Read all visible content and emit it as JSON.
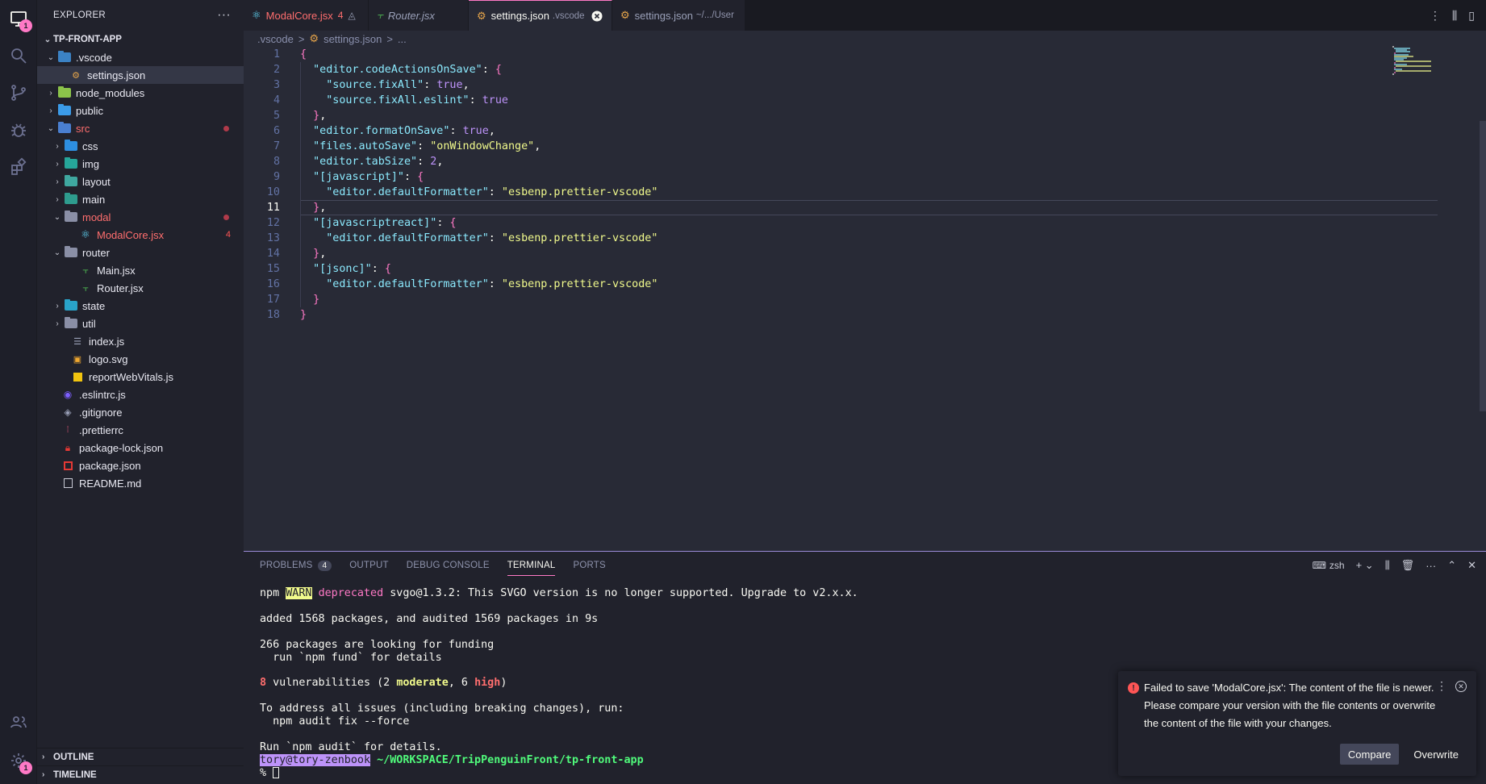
{
  "sidebar": {
    "title": "EXPLORER",
    "more": "···",
    "project": "TP-FRONT-APP",
    "tree": [
      {
        "label": "vscode_dot",
        "text": ".vscode"
      },
      {
        "text": "settings.json"
      },
      {
        "text": "node_modules"
      },
      {
        "text": "public"
      },
      {
        "text": "src"
      },
      {
        "text": "css"
      },
      {
        "text": "img"
      },
      {
        "text": "layout"
      },
      {
        "text": "main"
      },
      {
        "text": "modal"
      },
      {
        "text": "ModalCore.jsx",
        "count": "4"
      },
      {
        "text": "router"
      },
      {
        "text": "Main.jsx"
      },
      {
        "text": "Router.jsx"
      },
      {
        "text": "state"
      },
      {
        "text": "util"
      },
      {
        "text": "index.js"
      },
      {
        "text": "logo.svg"
      },
      {
        "text": "reportWebVitals.js"
      },
      {
        "text": ".eslintrc.js"
      },
      {
        "text": ".gitignore"
      },
      {
        "text": ".prettierrc"
      },
      {
        "text": "package-lock.json"
      },
      {
        "text": "package.json"
      },
      {
        "text": "README.md"
      }
    ],
    "outline": "OUTLINE",
    "timeline": "TIMELINE"
  },
  "activity": {
    "explorer_badge": "1",
    "settings_badge": "1"
  },
  "tabs": [
    {
      "label": "ModalCore.jsx",
      "count": "4"
    },
    {
      "label": "Router.jsx"
    },
    {
      "label": "settings.json",
      "desc": ".vscode"
    },
    {
      "label": "settings.json",
      "desc": "~/.../User"
    }
  ],
  "breadcrumb": {
    "part1": ".vscode",
    "sep": ">",
    "part2": "settings.json",
    "part3": "..."
  },
  "code": {
    "line_numbers": [
      "1",
      "2",
      "3",
      "4",
      "5",
      "6",
      "7",
      "8",
      "9",
      "10",
      "11",
      "12",
      "13",
      "14",
      "15",
      "16",
      "17",
      "18"
    ],
    "lines": [
      "{",
      "  \"editor.codeActionsOnSave\": {",
      "    \"source.fixAll\": true,",
      "    \"source.fixAll.eslint\": true",
      "  },",
      "  \"editor.formatOnSave\": true,",
      "  \"files.autoSave\": \"onWindowChange\",",
      "  \"editor.tabSize\": 2,",
      "  \"[javascript]\": {",
      "    \"editor.defaultFormatter\": \"esbenp.prettier-vscode\"",
      "  },",
      "  \"[javascriptreact]\": {",
      "    \"editor.defaultFormatter\": \"esbenp.prettier-vscode\"",
      "  },",
      "  \"[jsonc]\": {",
      "    \"editor.defaultFormatter\": \"esbenp.prettier-vscode\"",
      "  }",
      "}"
    ],
    "current_line": 11
  },
  "panel": {
    "tabs": [
      "PROBLEMS",
      "OUTPUT",
      "DEBUG CONSOLE",
      "TERMINAL",
      "PORTS"
    ],
    "problems_count": "4",
    "shell": "zsh"
  },
  "terminal": {
    "l1_a": "npm ",
    "l1_warn": "WARN",
    "l1_dep": "deprecated",
    "l1_b": " svgo@1.3.2: This SVGO version is no longer supported. Upgrade to v2.x.x.",
    "l2": "added 1568 packages, and audited 1569 packages in 9s",
    "l3": "266 packages are looking for funding",
    "l4": "  run `npm fund` for details",
    "l5_num": "8",
    "l5_a": " vulnerabilities (2 ",
    "l5_mod": "moderate",
    "l5_b": ", 6 ",
    "l5_high": "high",
    "l5_c": ")",
    "l6": "To address all issues (including breaking changes), run:",
    "l7": "  npm audit fix --force",
    "l8": "Run `npm audit` for details.",
    "user": "tory@tory-zenbook",
    "path": " ~/WORKSPACE/TripPenguinFront/tp-front-app",
    "prompt": "%"
  },
  "notification": {
    "message": "Failed to save 'ModalCore.jsx': The content of the file is newer. Please compare your version with the file contents or overwrite the content of the file with your changes.",
    "compare": "Compare",
    "overwrite": "Overwrite"
  },
  "colors": {
    "accent": "#ff79c6",
    "error": "#ff5555",
    "bg": "#282a36",
    "sidebar": "#21222c"
  }
}
